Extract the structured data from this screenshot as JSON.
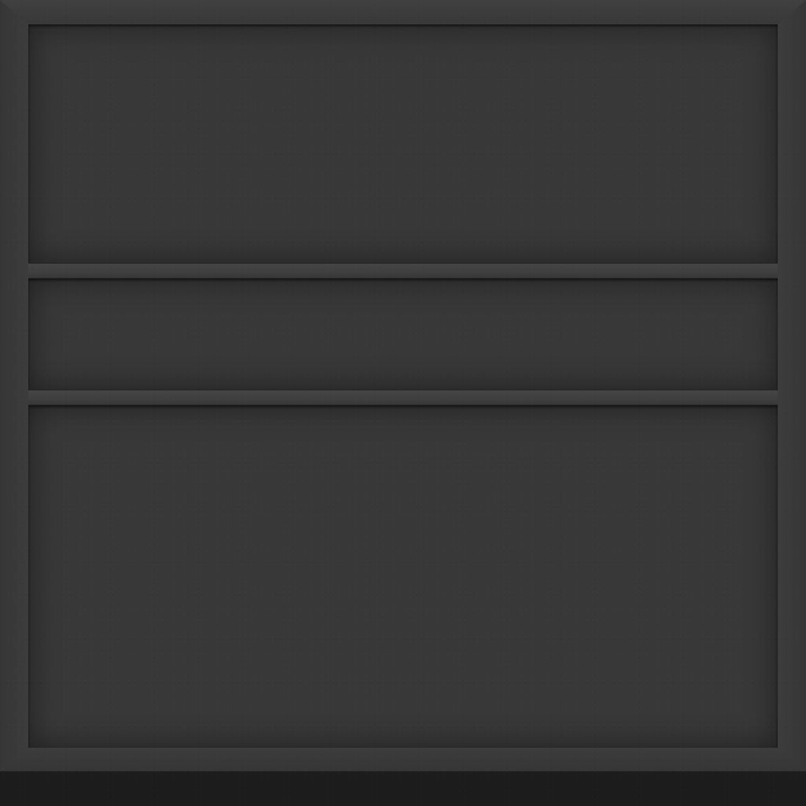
{
  "scene": {
    "colors": {
      "frame": "#3a3a3a",
      "panel": "#383838",
      "shelf": "#424242",
      "floor": "#1c1c1c"
    }
  }
}
